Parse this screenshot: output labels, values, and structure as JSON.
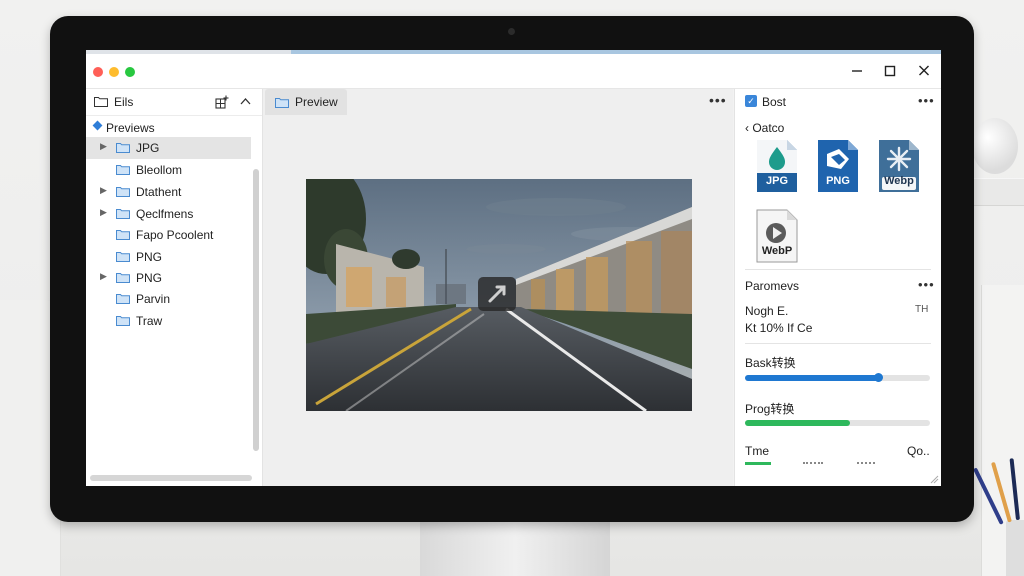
{
  "window": {
    "traffic_lights": [
      "#ff5f57",
      "#febc2e",
      "#28c840"
    ],
    "controls": {
      "minimize": "−",
      "maximize": "▢",
      "close": "✕"
    }
  },
  "left_panel": {
    "title": "Eils",
    "header_icons": [
      "grid-add-icon",
      "chevron-up-icon"
    ],
    "tree_root": "Previews",
    "items": [
      {
        "label": "JPG",
        "expandable": true,
        "selected": true
      },
      {
        "label": "Bleollom",
        "expandable": false
      },
      {
        "label": "Dtathent",
        "expandable": true
      },
      {
        "label": "Qeclfmens",
        "expandable": true
      },
      {
        "label": "Fapo Pcoolent",
        "expandable": false
      },
      {
        "label": "PNG",
        "expandable": false
      },
      {
        "label": "PNG",
        "expandable": true
      },
      {
        "label": "Parvin",
        "expandable": false
      },
      {
        "label": "Traw",
        "expandable": false
      }
    ]
  },
  "center": {
    "tab_label": "Preview",
    "more": "•••",
    "preview_icon": "expand-arrow-icon"
  },
  "right_panel": {
    "title": "Bost",
    "more": "•••",
    "back_label": "Oatco",
    "formats": [
      {
        "label": "JPG",
        "color": "#1f5f9e",
        "icon": "droplet-icon"
      },
      {
        "label": "PNG",
        "color": "#1f64ae",
        "icon": "arrow-icon"
      },
      {
        "label": "Webp",
        "color": "#3f6f99",
        "icon": "sparkle-icon"
      },
      {
        "label": "WebP",
        "color": "#f5f5f5",
        "icon": "play-icon"
      }
    ],
    "params": {
      "title": "Paromevs",
      "more": "•••",
      "line1": "Nogh E.",
      "line1_right": "TH",
      "line2": "Kt 10% If Ce"
    },
    "progress": [
      {
        "label": "Bask转换",
        "value": 0.72,
        "color": "#1f78d1"
      },
      {
        "label": "Prog转换",
        "value": 0.57,
        "color": "#2eb85c"
      }
    ],
    "footer": {
      "left": "Tme",
      "right": "Qo.."
    }
  }
}
